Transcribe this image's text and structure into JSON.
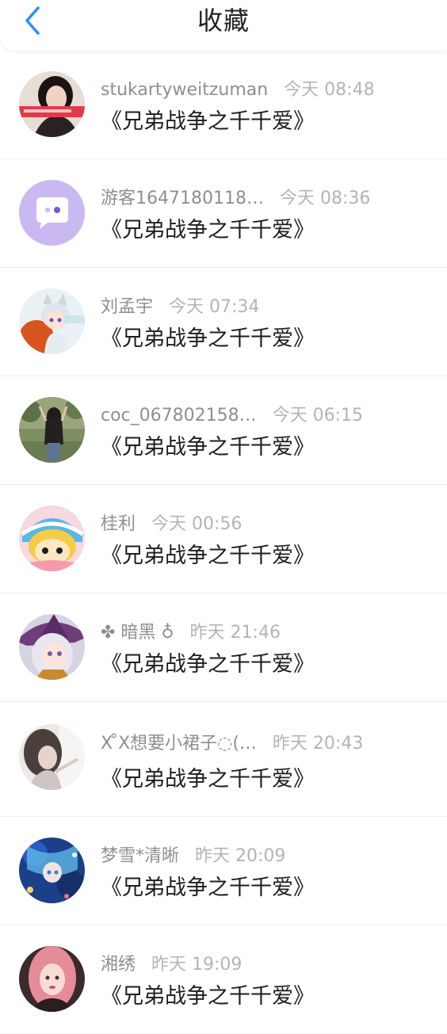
{
  "header": {
    "title": "收藏",
    "back_icon": "chevron-left-icon",
    "accent_color": "#2b8fff"
  },
  "items": [
    {
      "name": "stukartyweitzuman",
      "time": "今天 08:48",
      "work": "《兄弟战争之千千爱》",
      "avatar": "avatar-girl-photo"
    },
    {
      "name": "游客1647180118…",
      "time": "今天 08:36",
      "work": "《兄弟战争之千千爱》",
      "avatar": "default-chat-bubble-avatar"
    },
    {
      "name": "刘孟宇",
      "time": "今天 07:34",
      "work": "《兄弟战争之千千爱》",
      "avatar": "avatar-anime-cat-boy"
    },
    {
      "name": "coc_067802158…",
      "time": "今天 06:15",
      "work": "《兄弟战争之千千爱》",
      "avatar": "avatar-girl-park"
    },
    {
      "name": "桂利",
      "time": "今天 00:56",
      "work": "《兄弟战争之千千爱》",
      "avatar": "avatar-cartoon-blonde"
    },
    {
      "name": "✤ 暗黑 ♁",
      "time": "昨天 21:46",
      "work": "《兄弟战争之千千爱》",
      "avatar": "avatar-anime-witch"
    },
    {
      "name": "X ̊X想要小裙子◌(…",
      "time": "昨天 20:43",
      "work": "《兄弟战争之千千爱》",
      "avatar": "avatar-girl-soft"
    },
    {
      "name": "梦雪*清晰",
      "time": "昨天 20:09",
      "work": "《兄弟战争之千千爱》",
      "avatar": "avatar-anime-blue"
    },
    {
      "name": "湘绣",
      "time": "昨天 19:09",
      "work": "《兄弟战争之千千爱》",
      "avatar": "avatar-girl-pink-hair"
    }
  ]
}
